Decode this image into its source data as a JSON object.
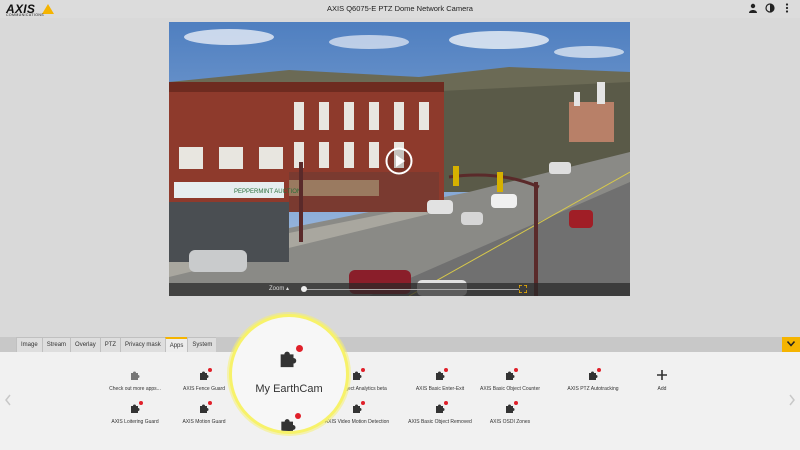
{
  "header": {
    "brand": "AXIS",
    "brand_sub": "COMMUNICATIONS",
    "title": "AXIS Q6075-E PTZ Dome Network Camera",
    "icons": [
      "user-icon",
      "contrast-icon",
      "more-vertical-icon"
    ]
  },
  "video": {
    "zoom_label": "Zoom",
    "zoom_level": 0.0,
    "storefront_text": "PEPPERMINT AUCTION"
  },
  "tabs": {
    "items": [
      "Image",
      "Stream",
      "Overlay",
      "PTZ",
      "Privacy mask",
      "Apps",
      "System"
    ],
    "active": "Apps"
  },
  "apps": {
    "row1": [
      {
        "label": "Check out more apps...",
        "dot": false
      },
      {
        "label": "AXIS Fence Guard",
        "dot": true
      },
      {
        "label": "My EarthCam",
        "dot": true
      },
      {
        "label": "AXIS Object Analytics beta",
        "dot": true
      },
      {
        "label": "AXIS Basic Enter-Exit",
        "dot": true
      },
      {
        "label": "AXIS Basic Object Counter",
        "dot": true
      },
      {
        "label": "AXIS PTZ Autotracking",
        "dot": true
      },
      {
        "label": "Add",
        "dot": false
      }
    ],
    "row2": [
      {
        "label": "AXIS Loitering Guard",
        "dot": true
      },
      {
        "label": "AXIS Motion Guard",
        "dot": true
      },
      {
        "label": "",
        "dot": true
      },
      {
        "label": "AXIS Video Motion Detection",
        "dot": true
      },
      {
        "label": "AXIS Basic Object Removed",
        "dot": true
      },
      {
        "label": "AXIS OSDI Zones",
        "dot": true
      }
    ]
  },
  "highlight": {
    "label": "My EarthCam"
  },
  "colors": {
    "accent": "#f5b400",
    "badge": "#e0202a",
    "highlight_ring": "#f7f26a"
  }
}
